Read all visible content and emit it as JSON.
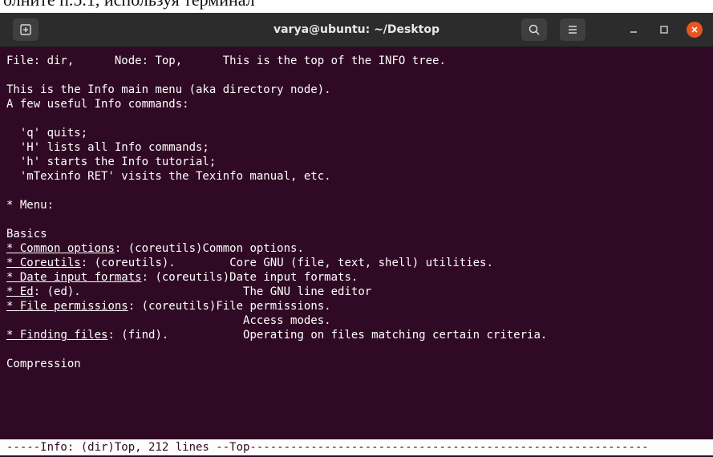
{
  "document_caption": "олните п.5.1, используя терминал",
  "window": {
    "title": "varya@ubuntu: ~/Desktop",
    "icons": {
      "new_tab": "new-tab-icon",
      "search": "search-icon",
      "menu": "hamburger-menu-icon",
      "minimize": "minimize-icon",
      "maximize": "maximize-icon",
      "close": "close-icon"
    },
    "colors": {
      "terminal_bg": "#300a24",
      "titlebar_bg": "#2c2c2c",
      "close_button": "#e95420",
      "text": "#ffffff"
    }
  },
  "terminal": {
    "header": {
      "file": "File: dir,",
      "node": "Node: Top,",
      "desc": "This is the top of the INFO tree."
    },
    "intro": [
      "This is the Info main menu (aka directory node).",
      "A few useful Info commands:"
    ],
    "commands": [
      "  'q' quits;",
      "  'H' lists all Info commands;",
      "  'h' starts the Info tutorial;",
      "  'mTexinfo RET' visits the Texinfo manual, etc."
    ],
    "menu_heading": "* Menu:",
    "section_basics": "Basics",
    "menu_items": [
      {
        "star": "*",
        "name": "Common options",
        "ref": ": (coreutils)",
        "desc": "Common options."
      },
      {
        "star": "*",
        "name": "Coreutils",
        "ref": ": (coreutils).",
        "desc": "Core GNU (file, text, shell) utilities."
      },
      {
        "star": "*",
        "name": "Date input formats",
        "ref": ": (coreutils)",
        "desc": "Date input formats."
      },
      {
        "star": "*",
        "name": "Ed",
        "ref": ": (ed).",
        "desc": "The GNU line editor"
      },
      {
        "star": "*",
        "name": "File permissions",
        "ref": ": (coreutils)",
        "desc": "File permissions."
      },
      {
        "star": "",
        "name": "",
        "ref": "",
        "desc": "Access modes."
      },
      {
        "star": "*",
        "name": "Finding files",
        "ref": ": (find).",
        "desc": "Operating on files matching certain criteria."
      }
    ],
    "section_compression": "Compression",
    "status_line": "-----Info: (dir)Top, 212 lines --Top-----------------------------------------------------------"
  }
}
